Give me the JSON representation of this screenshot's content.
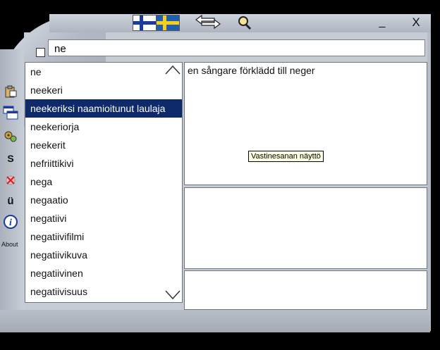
{
  "titlebar": {
    "source_flag": "flag-finland-icon",
    "target_flag": "flag-sweden-icon",
    "swap_icon": "swap-arrows-icon",
    "zoom_icon": "magnifier-icon",
    "minimize_label": "_",
    "close_label": "X"
  },
  "search": {
    "value": "ne"
  },
  "toolbar": {
    "s_label": "S",
    "u_label": "ü",
    "info_label": "i",
    "about_label": "About"
  },
  "word_list": {
    "items": [
      "ne",
      "neekeri",
      "neekeriksi naamioitunut laulaja",
      "neekeriorja",
      "neekerit",
      "nefriittikivi",
      "nega",
      "negaatio",
      "negatiivi",
      "negatiivifilmi",
      "negatiivikuva",
      "negatiivinen",
      "negatiivisuus"
    ],
    "selected_index": 2
  },
  "translation": {
    "text": "en sångare förklädd till neger",
    "tooltip": "Vastinesanan näyttö"
  },
  "colors": {
    "selection": "#0e2a6b",
    "chrome": "#b3bac5",
    "tooltip_bg": "#ffffe1"
  }
}
